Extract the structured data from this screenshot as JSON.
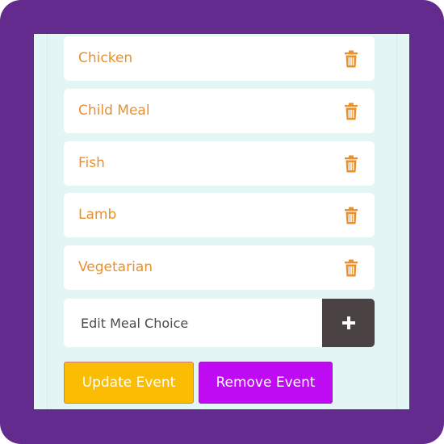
{
  "meal_choices": [
    {
      "label": "Chicken",
      "icon": "trash-icon"
    },
    {
      "label": "Child Meal",
      "icon": "trash-icon"
    },
    {
      "label": "Fish",
      "icon": "trash-icon"
    },
    {
      "label": "Lamb",
      "icon": "trash-icon"
    },
    {
      "label": "Vegetarian",
      "icon": "trash-icon"
    }
  ],
  "input": {
    "placeholder": "Edit Meal Choice",
    "value": ""
  },
  "add_button": {
    "icon": "plus-icon"
  },
  "actions": {
    "update_label": "Update Event",
    "remove_label": "Remove Event"
  },
  "colors": {
    "frame": "#632b8e",
    "panel": "#e4f5f5",
    "meal_text": "#e8912e",
    "add_button": "#4b4343",
    "update_button": "#fbbc04",
    "remove_button": "#be0bf2"
  }
}
